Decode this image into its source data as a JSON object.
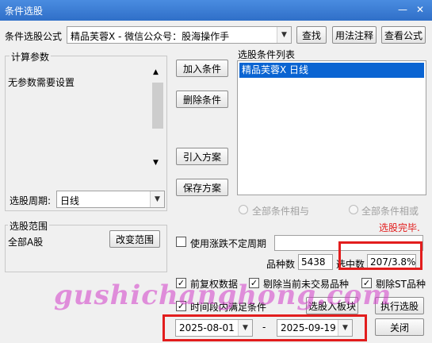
{
  "window": {
    "title": "条件选股"
  },
  "formula_row": {
    "label": "条件选股公式",
    "combo_value": "精品芙蓉X  -  微信公众号：股海操作手",
    "find_button": "查找",
    "usage_button": "用法注释",
    "view_button": "查看公式"
  },
  "params": {
    "group_title": "计算参数",
    "text": "无参数需要设置",
    "period_label": "选股周期:",
    "period_value": "日线"
  },
  "actions": {
    "add": "加入条件",
    "delete": "删除条件",
    "import": "引入方案",
    "save": "保存方案"
  },
  "conditions": {
    "title": "选股条件列表",
    "items": [
      "精品芙蓉X  日线"
    ],
    "radio_and": "全部条件相与",
    "radio_or": "全部条件相或"
  },
  "status": {
    "text": "选股完毕.",
    "color": "#e21d1d"
  },
  "range": {
    "group_title": "选股范围",
    "value": "全部A股",
    "change_button": "改变范围"
  },
  "stats": {
    "uncertain_label": "使用涨跌不定周期",
    "count_label": "品种数",
    "count_value": "5438",
    "selected_label": "选中数",
    "selected_value": "207/3.8%"
  },
  "options": {
    "pre_adjust": "前复权数据",
    "exclude_untraded": "剔除当前未交易品种",
    "exclude_st": "剔除ST品种",
    "time_range": "时间段内满足条件",
    "to_board_button": "选股入板块",
    "execute_button": "执行选股"
  },
  "dates": {
    "start": "2025-08-01",
    "separator": "-",
    "end": "2025-09-19",
    "close_button": "关闭"
  },
  "watermark": "gushichanghong.com",
  "colors": {
    "accent": "#3a7bd5",
    "highlight": "#e21d1d",
    "selection": "#0a64d2"
  }
}
